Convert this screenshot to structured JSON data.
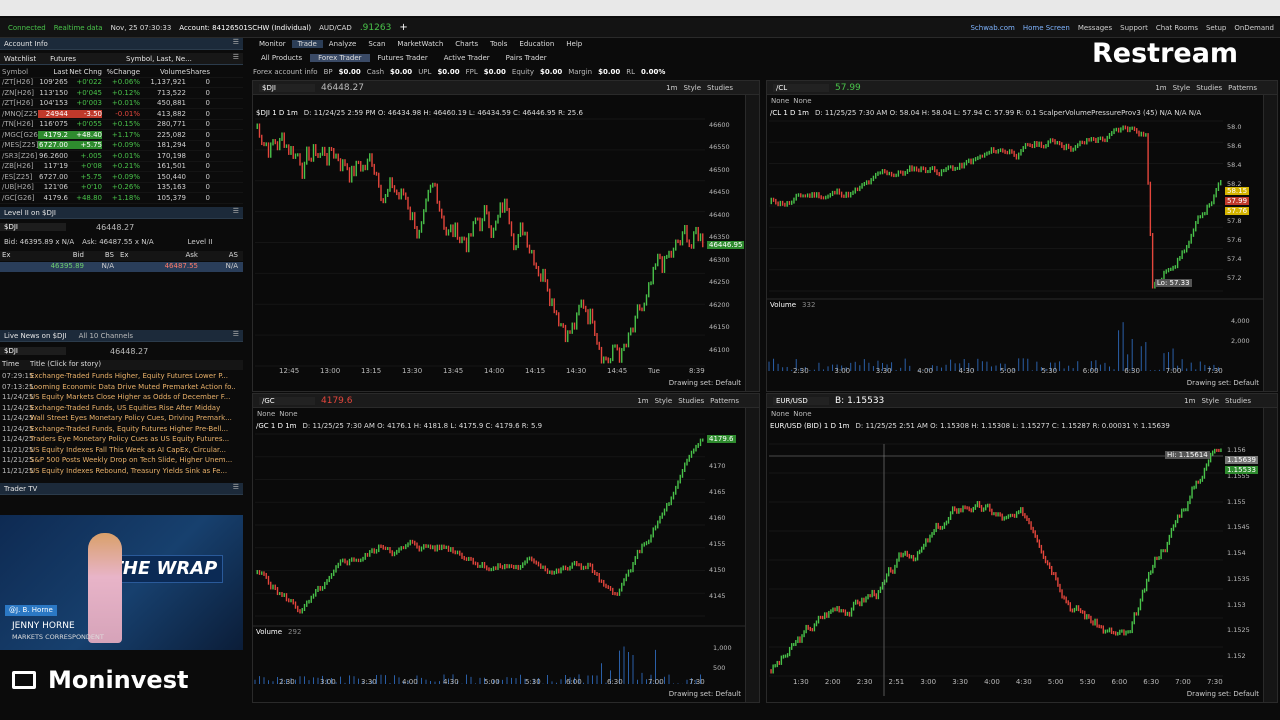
{
  "status": {
    "connected": "Connected",
    "realtime": "Realtime data",
    "datetime": "Nov, 25  07:30:33",
    "account": "Account: 84126501SCHW (Individual)",
    "pair": "AUD/CAD",
    "pair_value": ".91263",
    "schwab": "Schwab.com",
    "home": "Home Screen",
    "messages": "Messages",
    "support": "Support",
    "chat": "Chat Rooms",
    "setup": "Setup",
    "ondemand": "OnDemand"
  },
  "watermarks": {
    "restream": "Restream",
    "moninvest": "Moninvest"
  },
  "left": {
    "account_info": "Account Info",
    "watchlist_label": "Watchlist",
    "watchlist_name": "Futures",
    "symbol_search": "Symbol, Last, Ne...",
    "columns": [
      "Symbol",
      "Last",
      "Net Chng",
      "%Change",
      "Volume",
      "Shares"
    ],
    "rows": [
      {
        "sym": "/ZT[H26]",
        "last": "109'265",
        "net": "+0'022",
        "pct": "+0.06%",
        "vol": "1,137,921",
        "sh": "0",
        "dir": "up",
        "bg": ""
      },
      {
        "sym": "/ZN[H26]",
        "last": "113'150",
        "net": "+0'045",
        "pct": "+0.12%",
        "vol": "713,522",
        "sh": "0",
        "dir": "up",
        "bg": ""
      },
      {
        "sym": "/ZT[H26]",
        "last": "104'153",
        "net": "+0'003",
        "pct": "+0.01%",
        "vol": "450,881",
        "sh": "0",
        "dir": "up",
        "bg": ""
      },
      {
        "sym": "/MNQ[Z25]",
        "last": "24944",
        "net": "-3.50",
        "pct": "-0.01%",
        "vol": "413,882",
        "sh": "0",
        "dir": "dn",
        "bg": "dn"
      },
      {
        "sym": "/TN[H26]",
        "last": "116'075",
        "net": "+0'055",
        "pct": "+0.15%",
        "vol": "280,771",
        "sh": "0",
        "dir": "up",
        "bg": ""
      },
      {
        "sym": "/MGC[G26]",
        "last": "4179.2",
        "net": "+48.40",
        "pct": "+1.17%",
        "vol": "225,082",
        "sh": "0",
        "dir": "up",
        "bg": "up"
      },
      {
        "sym": "/MES[Z25]",
        "last": "6727.00",
        "net": "+5.75",
        "pct": "+0.09%",
        "vol": "181,294",
        "sh": "0",
        "dir": "up",
        "bg": "up"
      },
      {
        "sym": "/SR3[Z26]",
        "last": "96.2600",
        "net": "+.005",
        "pct": "+0.01%",
        "vol": "170,198",
        "sh": "0",
        "dir": "up",
        "bg": ""
      },
      {
        "sym": "/ZB[H26]",
        "last": "117'19",
        "net": "+0'08",
        "pct": "+0.21%",
        "vol": "161,501",
        "sh": "0",
        "dir": "up",
        "bg": ""
      },
      {
        "sym": "/ES[Z25]",
        "last": "6727.00",
        "net": "+5.75",
        "pct": "+0.09%",
        "vol": "150,440",
        "sh": "0",
        "dir": "up",
        "bg": ""
      },
      {
        "sym": "/UB[H26]",
        "last": "121'06",
        "net": "+0'10",
        "pct": "+0.26%",
        "vol": "135,163",
        "sh": "0",
        "dir": "up",
        "bg": ""
      },
      {
        "sym": "/GC[G26]",
        "last": "4179.6",
        "net": "+48.80",
        "pct": "+1.18%",
        "vol": "105,379",
        "sh": "0",
        "dir": "up",
        "bg": ""
      }
    ],
    "level2_title": "Level II on $DJI",
    "level2_symbol": "$DJI",
    "level2_price": "46448.27",
    "level2_label": "Level II",
    "bid_line": "Bid: 46395.89 x N/A",
    "ask_line": "Ask: 46487.55 x N/A",
    "level2_cols": [
      "Ex",
      "Bid",
      "BS",
      "Ex",
      "Ask",
      "AS"
    ],
    "level2_bid": "46395.89",
    "level2_ask": "46487.55",
    "level2_na": "N/A",
    "news_title": "Live News on $DJI",
    "news_channels": "All 10 Channels",
    "news_symbol": "$DJI",
    "news_price": "46448.27",
    "news_cols": [
      "Time",
      "Title (Click for story)"
    ],
    "news": [
      {
        "t": "07:29:15",
        "h": "Exchange-Traded Funds Higher, Equity Futures Lower P..."
      },
      {
        "t": "07:13:25",
        "h": "Looming Economic Data Drive Muted Premarket Action fo..."
      },
      {
        "t": "11/24/25",
        "h": "US Equity Markets Close Higher as Odds of December F..."
      },
      {
        "t": "11/24/25",
        "h": "Exchange-Traded Funds, US Equities Rise After Midday"
      },
      {
        "t": "11/24/25",
        "h": "Wall Street Eyes Monetary Policy Cues, Driving Premark..."
      },
      {
        "t": "11/24/25",
        "h": "Exchange-Traded Funds, Equity Futures Higher Pre-Bell..."
      },
      {
        "t": "11/24/25",
        "h": "Traders Eye Monetary Policy Cues as US Equity Futures..."
      },
      {
        "t": "11/21/25",
        "h": "US Equity Indexes Fall This Week as AI CapEx, Circular..."
      },
      {
        "t": "11/21/25",
        "h": "S&P 500 Posts Weekly Drop on Tech Slide, Higher Unem..."
      },
      {
        "t": "11/21/25",
        "h": "US Equity Indexes Rebound, Treasury Yields Sink as Fe..."
      }
    ],
    "tv_title": "Trader TV",
    "tv_banner": "THE WRAP",
    "tv_handle": "@J. B. Horne",
    "tv_name": "JENNY HORNE",
    "tv_role": "MARKETS CORRESPONDENT"
  },
  "nav": {
    "tabs": [
      "Monitor",
      "Trade",
      "Analyze",
      "Scan",
      "MarketWatch",
      "Charts",
      "Tools",
      "Education",
      "Help"
    ],
    "subtabs": [
      "All Products",
      "Forex Trader",
      "Futures Trader",
      "Active Trader",
      "Pairs Trader"
    ],
    "fx": [
      {
        "k": "Forex account info",
        "v": ""
      },
      {
        "k": "BP",
        "v": "$0.00"
      },
      {
        "k": "Cash",
        "v": "$0.00"
      },
      {
        "k": "UPL",
        "v": "$0.00"
      },
      {
        "k": "FPL",
        "v": "$0.00"
      },
      {
        "k": "Equity",
        "v": "$0.00"
      },
      {
        "k": "Margin",
        "v": "$0.00"
      },
      {
        "k": "RL",
        "v": "0.00%"
      }
    ]
  },
  "panels": {
    "dji": {
      "symbol": "$DJI",
      "price": "46448.27",
      "label": "$DJI 1 D 1m",
      "info": "D: 11/24/25 2:59 PM   O: 46434.98   H: 46460.19   L: 46434.59   C: 46446.95   R: 25.6",
      "price_tag": "46446.95",
      "yticks": [
        "46600",
        "46550",
        "46500",
        "46450",
        "46400",
        "46350",
        "46300",
        "46250",
        "46200",
        "46150",
        "46100"
      ],
      "xticks": [
        "12:45",
        "13:00",
        "13:15",
        "13:30",
        "13:45",
        "14:00",
        "14:15",
        "14:30",
        "14:45",
        "Tue",
        "8:39"
      ],
      "drawing": "Drawing set: Default"
    },
    "cl": {
      "symbol": "/CL",
      "price": "57.99",
      "label": "/CL 1 D 1m",
      "info": "D: 11/25/25 7:30 AM   O: 58.04   H: 58.04   L: 57.94   C: 57.99   R: 0.1   ScalperVolumePressureProv3 (45)   N/A   N/A   N/A",
      "low_label": "Lo: 57.33",
      "tags": [
        "58.15",
        "57.99",
        "57.76"
      ],
      "yticks": [
        "58.0",
        "58.6",
        "58.4",
        "58.2",
        "58.0",
        "57.8",
        "57.6",
        "57.4",
        "57.2"
      ],
      "volume_label": "Volume",
      "volume_value": "332",
      "vticks": [
        "4,000",
        "2,000"
      ],
      "xticks": [
        "2:30",
        "3:00",
        "3:30",
        "4:00",
        "4:30",
        "5:00",
        "5:30",
        "6:00",
        "6:30",
        "7:00",
        "7:30"
      ],
      "drawing": "Drawing set: Default",
      "none": "None"
    },
    "gc": {
      "symbol": "/GC",
      "price": "4179.6",
      "label": "/GC 1 D 1m",
      "info": "D: 11/25/25 7:30 AM   O: 4176.1   H: 4181.8   L: 4175.9   C: 4179.6   R: 5.9",
      "price_tag": "4179.6",
      "yticks": [
        "4175",
        "4170",
        "4165",
        "4160",
        "4155",
        "4150",
        "4145"
      ],
      "volume_label": "Volume",
      "volume_value": "292",
      "vticks": [
        "1,000",
        "500"
      ],
      "xticks": [
        "2:30",
        "3:00",
        "3:30",
        "4:00",
        "4:30",
        "5:00",
        "5:30",
        "6:00",
        "6:30",
        "7:00",
        "7:30"
      ],
      "drawing": "Drawing set: Default",
      "none": "None"
    },
    "eur": {
      "symbol": "EUR/USD",
      "price": "B: 1.15533",
      "label": "EUR/USD (BID) 1 D 1m",
      "info": "D: 11/25/25 2:51 AM   O: 1.15308   H: 1.15308   L: 1.15277   C: 1.15287   R: 0.00031   Y: 1.15639",
      "hi_label": "Hi: 1.15614",
      "tags": [
        "1.15639",
        "1.15533"
      ],
      "yticks": [
        "1.156",
        "1.1555",
        "1.155",
        "1.1545",
        "1.154",
        "1.1535",
        "1.153",
        "1.1525",
        "1.152"
      ],
      "xticks": [
        "1:30",
        "2:00",
        "2:30",
        "2:51",
        "3:00",
        "3:30",
        "4:00",
        "4:30",
        "5:00",
        "5:30",
        "6:00",
        "6:30",
        "7:00",
        "7:30"
      ],
      "drawing": "Drawing set: Default",
      "none": "None"
    }
  },
  "toolbar": {
    "style": "Style",
    "studies": "Studies",
    "patterns": "Patterns",
    "tf": "1m"
  },
  "colors": {
    "up": "#49c24a",
    "down": "#e4463c",
    "accent": "#2c3e57"
  }
}
